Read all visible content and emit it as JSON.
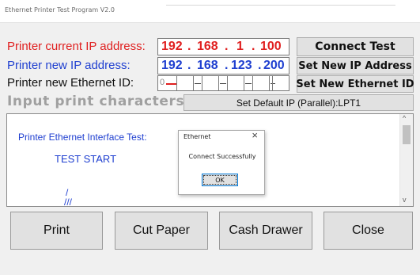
{
  "window": {
    "title": "Ethernet Printer Test Program V2.0"
  },
  "labels": {
    "current_ip": "Printer current IP address:",
    "new_ip": "Printer new IP address:",
    "new_eth_id": "Printer new Ethernet ID:",
    "input_chars": "Input print characters:"
  },
  "current_ip": {
    "o1": "192",
    "o2": "168",
    "o3": "1",
    "o4": "100",
    "dots": [
      ".",
      ".",
      "."
    ]
  },
  "new_ip": {
    "o1": "192",
    "o2": "168",
    "o3": "123",
    "o4": "200",
    "dots": [
      ".",
      ".",
      "."
    ]
  },
  "ethernet_id": {
    "first": "0"
  },
  "buttons": {
    "connect_test": "Connect Test",
    "set_new_ip": "Set New IP Address",
    "set_new_eth": "Set New Ethernet ID",
    "set_default_ip": "Set Default IP (Parallel):LPT1",
    "print": "Print",
    "cut_paper": "Cut Paper",
    "cash_drawer": "Cash Drawer",
    "close": "Close"
  },
  "output": {
    "lines": [
      "Printer Ethernet Interface Test:",
      "TEST  START",
      "/",
      "///"
    ]
  },
  "dialog": {
    "title": "Ethernet",
    "close_glyph": "×",
    "message": "Connect Successfully",
    "ok": "OK"
  },
  "scroll": {
    "up": "^",
    "down": "v"
  },
  "colors": {
    "red": "#e02020",
    "blue": "#1f3fd0",
    "gray_label": "#a0a0a0"
  }
}
